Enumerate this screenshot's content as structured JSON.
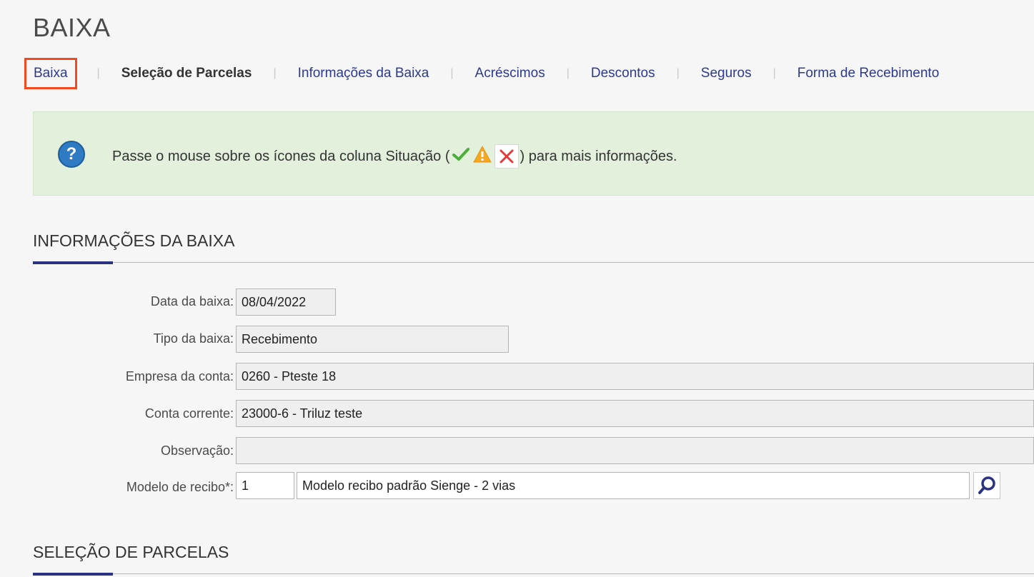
{
  "page": {
    "title": "BAIXA"
  },
  "tabs": [
    {
      "label": "Baixa"
    },
    {
      "label": "Seleção de Parcelas"
    },
    {
      "label": "Informações da Baixa"
    },
    {
      "label": "Acréscimos"
    },
    {
      "label": "Descontos"
    },
    {
      "label": "Seguros"
    },
    {
      "label": "Forma de Recebimento"
    }
  ],
  "info": {
    "text_before": "Passe o mouse sobre os ícones da coluna Situação (",
    "text_after": ") para mais informações.",
    "help_icon": "question-icon",
    "status_icons": [
      "check-icon",
      "warning-icon",
      "x-icon"
    ]
  },
  "sections": {
    "info_baixa": "INFORMAÇÕES DA BAIXA",
    "selecao_parcelas": "SELEÇÃO DE PARCELAS"
  },
  "form": {
    "data_baixa": {
      "label": "Data da baixa:",
      "value": "08/04/2022"
    },
    "tipo_baixa": {
      "label": "Tipo da baixa:",
      "value": "Recebimento"
    },
    "empresa_conta": {
      "label": "Empresa da conta:",
      "value": "0260 - Pteste 18"
    },
    "conta_corrente": {
      "label": "Conta corrente:",
      "value": "23000-6 - Triluz teste"
    },
    "observacao": {
      "label": "Observação:",
      "value": ""
    },
    "modelo_recibo": {
      "label": "Modelo de recibo*:",
      "code": "1",
      "description": "Modelo recibo padrão Sienge - 2 vias"
    }
  },
  "colors": {
    "accent": "#2a3383",
    "link": "#2d3a8c",
    "highlight_border": "#f04a23",
    "info_bg": "#e2f0dc",
    "help_icon": "#2e7bc4",
    "check": "#4caf3a",
    "warning": "#f5a623",
    "error": "#e03a3a"
  }
}
